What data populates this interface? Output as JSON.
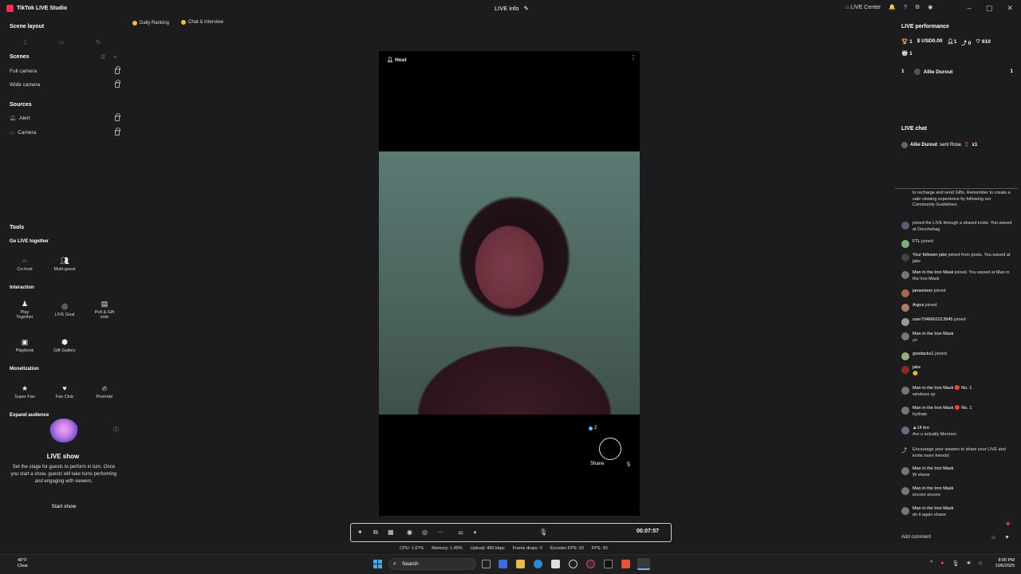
{
  "titlebar": {
    "app_name": "TikTok LIVE Studio",
    "center_title": "LIVE info",
    "live_center": "LIVE Center"
  },
  "left": {
    "scene_layout_title": "Scene layout",
    "scenes_title": "Scenes",
    "scenes": [
      "Full camera",
      "Wide camera"
    ],
    "sources_title": "Sources",
    "sources": [
      "Alert",
      "Camera"
    ],
    "tools_title": "Tools",
    "go_live_together": "Go LIVE together",
    "go_live_tools": [
      "Co-host",
      "Multi-guest"
    ],
    "interaction_title": "Interaction",
    "interaction_tools": [
      "Play Together",
      "LIVE Goal",
      "Poll & Gift vote",
      "Playbook",
      "Gift Gallery"
    ],
    "monetization_title": "Monetization",
    "monetization_tools": [
      "Super Fan",
      "Fan Club",
      "Promote"
    ],
    "expand_title": "Expand audience",
    "live_show_title": "LIVE show",
    "live_show_desc": "Set the stage for guests to perform in turn. Once you start a show, guests will take turns performing and engaging with viewers.",
    "start_show": "Start show"
  },
  "scene_tabs": [
    "Daily Ranking",
    "Chat & Interview"
  ],
  "preview": {
    "host_label": "Host",
    "guest_name": "Shane",
    "guest_count": "2"
  },
  "controls": {
    "timer": "00:07:57",
    "stats": [
      "CPU: 1.67%",
      "Memory: 1.45%",
      "Upload: 400 kbps",
      "Frame drops: 0",
      "Encoder FPS: 30",
      "FPS: 30"
    ]
  },
  "right": {
    "perf_title": "LIVE performance",
    "perf_stats": [
      "1",
      "USD0.00",
      "1",
      "0",
      "610"
    ],
    "perf_gifts": "1",
    "rank": {
      "pos": "1",
      "name": "Allie Durout",
      "value": "1"
    },
    "chat_title": "LIVE chat",
    "gift_line": {
      "user": "Allie Durout",
      "action": "sent Rose",
      "count": "x1"
    },
    "chat": [
      {
        "user": "",
        "text": "to recharge and send Gifts. Remember to create a safe viewing experience by following our Community Guidelines."
      },
      {
        "user": "",
        "text": "joined the LIVE through a shared invite. You waved at Douchebag"
      },
      {
        "user": "FTL",
        "text": "joined"
      },
      {
        "user": "Your follower jake",
        "text": "joined from posts. You waved at jake"
      },
      {
        "user": "Man in the Iron Mask",
        "text": "joined. You waved at Man in the Iron Mask"
      },
      {
        "user": "jamesmon",
        "text": "joined"
      },
      {
        "user": "Argos",
        "text": "joined"
      },
      {
        "user": "user7046661013845",
        "text": "joined"
      },
      {
        "user": "Man in the Iron Mask",
        "text": "yo"
      },
      {
        "user": "goodacks1",
        "text": "joined"
      },
      {
        "user": "jake",
        "text": "🙂"
      },
      {
        "user": "Man in the Iron Mask 🔴 No. 1",
        "text": "windows xp"
      },
      {
        "user": "Man in the Iron Mask 🔴 No. 1",
        "text": "hydrate"
      },
      {
        "user": "▲14 bre",
        "text": "Are u actually Mormon"
      },
      {
        "user": "",
        "text": "Encourage your viewers to share your LIVE and invite more friends!"
      },
      {
        "user": "Man in the Iron Mask",
        "text": "W shane"
      },
      {
        "user": "Man in the Iron Mask",
        "text": "encore encore"
      },
      {
        "user": "Man in the Iron Mask",
        "text": "do it again shane"
      }
    ],
    "add_comment": "Add comment"
  },
  "taskbar": {
    "weather_temp": "46°F",
    "weather_desc": "Clear",
    "search": "Search",
    "time": "8:00 PM",
    "date": "10/6/2025"
  }
}
